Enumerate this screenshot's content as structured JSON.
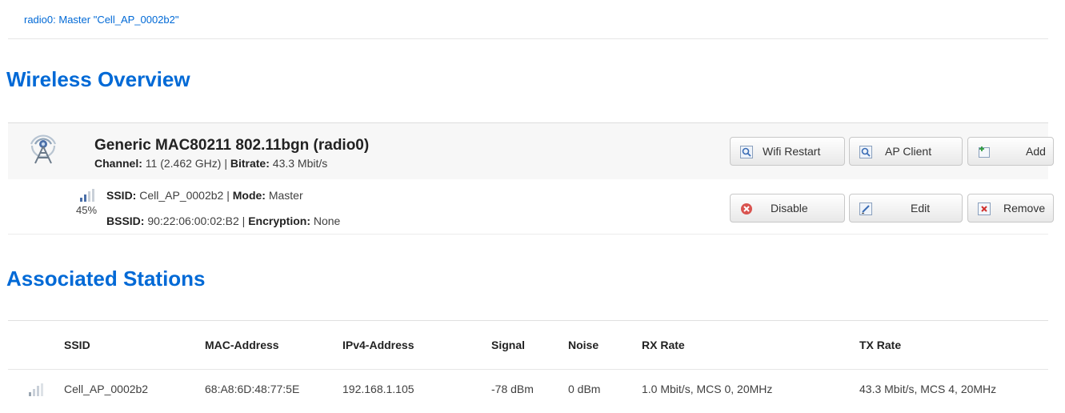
{
  "tab": {
    "label": "radio0: Master \"Cell_AP_0002b2\""
  },
  "overview": {
    "heading": "Wireless Overview",
    "radio": {
      "title": "Generic MAC80211 802.11bgn (radio0)",
      "channel_label": "Channel:",
      "channel_value": " 11 (2.462 GHz) | ",
      "bitrate_label": "Bitrate:",
      "bitrate_value": " 43.3 Mbit/s",
      "icon": "wireless-antenna-icon",
      "buttons": {
        "restart": "Wifi Restart",
        "ap_client": "AP Client",
        "add": "Add"
      }
    },
    "network": {
      "signal_percent": "45%",
      "signal_icon": "signal-strength-icon",
      "ssid_label": "SSID:",
      "ssid_value": " Cell_AP_0002b2 | ",
      "mode_label": "Mode:",
      "mode_value": " Master",
      "bssid_label": "BSSID:",
      "bssid_value": " 90:22:06:00:02:B2 | ",
      "encryption_label": "Encryption:",
      "encryption_value": " None",
      "buttons": {
        "disable": "Disable",
        "edit": "Edit",
        "remove": "Remove"
      }
    }
  },
  "stations": {
    "heading": "Associated Stations",
    "columns": [
      "SSID",
      "MAC-Address",
      "IPv4-Address",
      "Signal",
      "Noise",
      "RX Rate",
      "TX Rate"
    ],
    "rows": [
      {
        "ssid": "Cell_AP_0002b2",
        "mac": "68:A8:6D:48:77:5E",
        "ipv4": "192.168.1.105",
        "signal": "-78 dBm",
        "noise": "0 dBm",
        "rx_rate": "1.0 Mbit/s, MCS 0, 20MHz",
        "tx_rate": "43.3 Mbit/s, MCS 4, 20MHz"
      }
    ]
  },
  "colors": {
    "accent": "#0069d6",
    "row_bg": "#f7f7f7"
  }
}
